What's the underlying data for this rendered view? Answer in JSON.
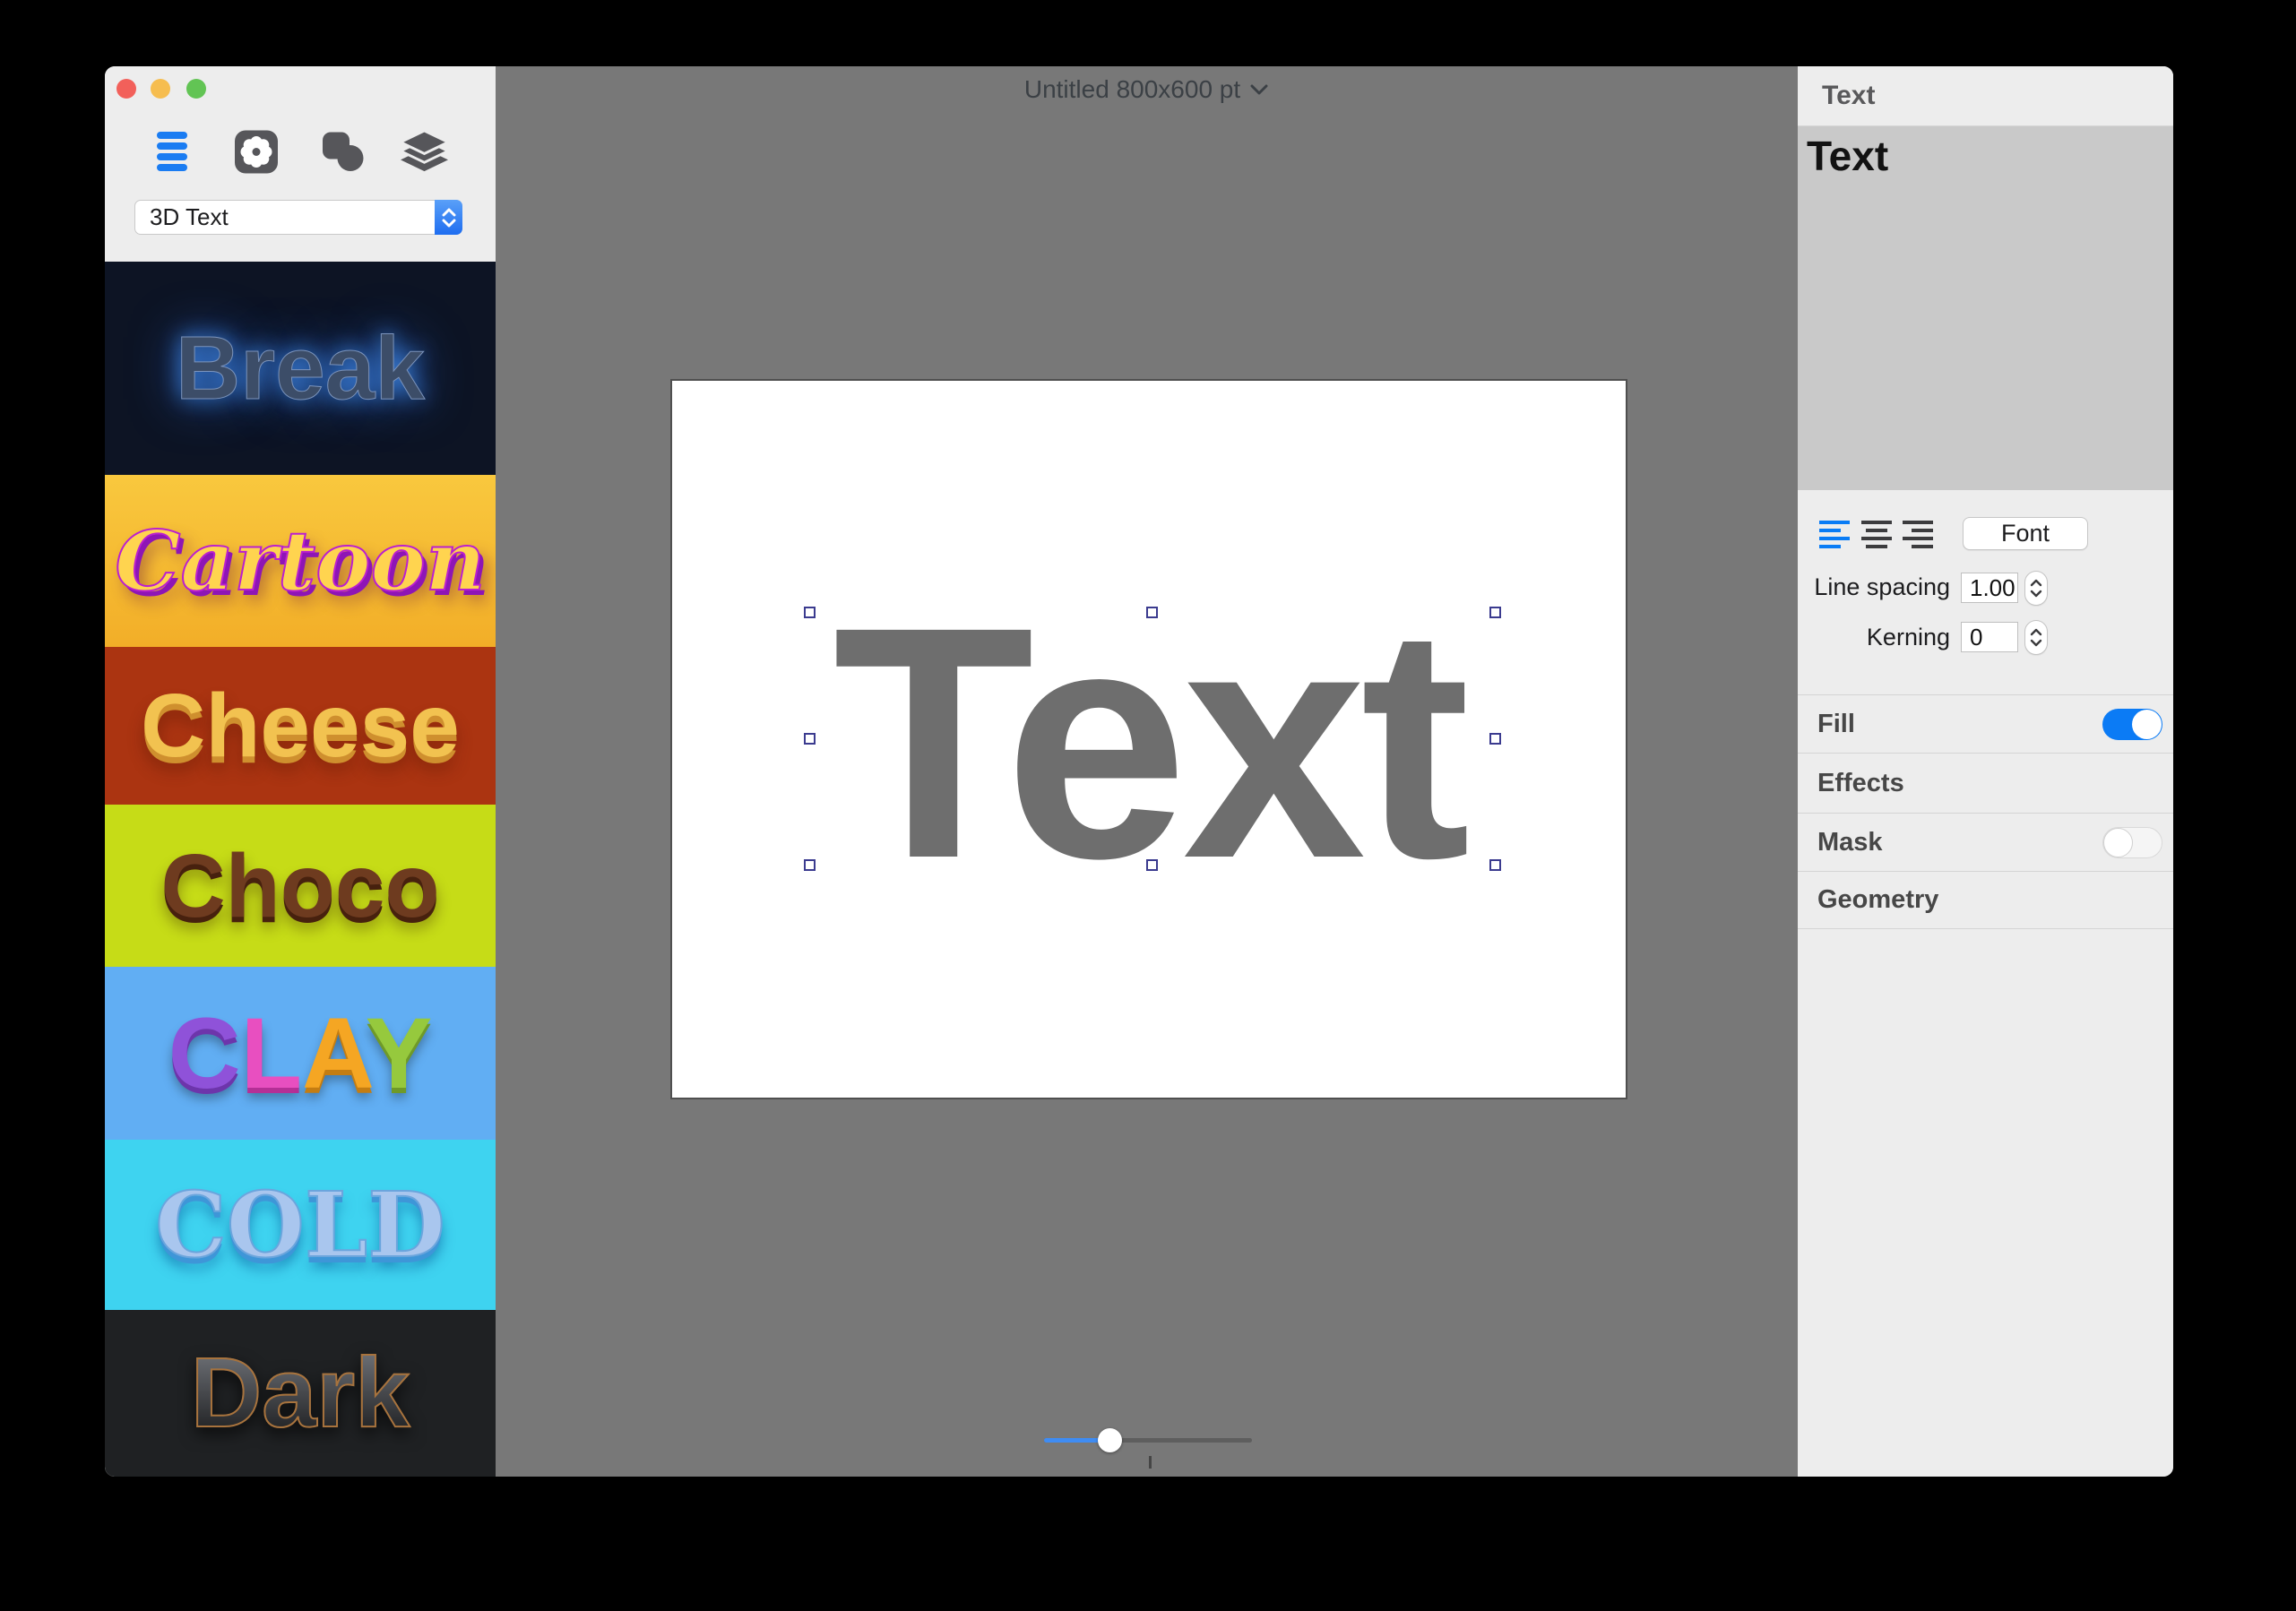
{
  "window": {
    "title": "Untitled 800x600 pt"
  },
  "sidebar": {
    "style_dropdown": {
      "value": "3D Text"
    },
    "templates": [
      {
        "name": "Break"
      },
      {
        "name": "Cartoon"
      },
      {
        "name": "Cheese"
      },
      {
        "name": "Choco"
      },
      {
        "name": "CLAY",
        "letters": [
          "C",
          "L",
          "A",
          "Y"
        ]
      },
      {
        "name": "COLD"
      },
      {
        "name": "Dark"
      }
    ]
  },
  "canvas": {
    "text": "Text"
  },
  "inspector": {
    "header": "Text",
    "content_text": "Text",
    "font_button": "Font",
    "line_spacing_label": "Line spacing",
    "line_spacing_value": "1.00",
    "kerning_label": "Kerning",
    "kerning_value": "0",
    "sections": [
      {
        "label": "Fill",
        "toggle": "on"
      },
      {
        "label": "Effects"
      },
      {
        "label": "Mask",
        "toggle": "off"
      },
      {
        "label": "Geometry"
      }
    ]
  },
  "colors": {
    "accent_blue": "#0b7bf5",
    "canvas_gray": "#787878",
    "panel_gray": "#ededed",
    "editor_gray": "#c9c9c9",
    "tile_break": "#0d1424",
    "tile_cartoon": "#f6bb32",
    "tile_cheese": "#ab3411",
    "tile_choco": "#c6dc17",
    "tile_clay": "#61aef3",
    "tile_cold": "#3ed3f0",
    "tile_dark": "#1f2123"
  }
}
